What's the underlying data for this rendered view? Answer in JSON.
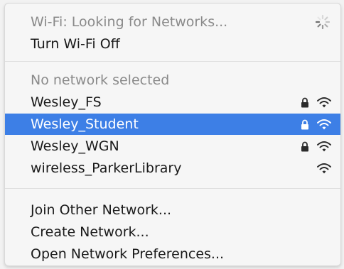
{
  "menu": {
    "status_item": "Wi-Fi: Looking for Networks...",
    "toggle_item": "Turn Wi-Fi Off",
    "section_header": "No network selected",
    "networks": [
      {
        "name": "Wesley_FS",
        "locked": true,
        "selected": false
      },
      {
        "name": "Wesley_Student",
        "locked": true,
        "selected": true
      },
      {
        "name": "Wesley_WGN",
        "locked": true,
        "selected": false
      },
      {
        "name": "wireless_ParkerLibrary",
        "locked": false,
        "selected": false
      }
    ],
    "actions": [
      "Join Other Network...",
      "Create Network...",
      "Open Network Preferences..."
    ]
  },
  "icons": {
    "spinner": "loading-spinner-icon",
    "lock": "lock-icon",
    "wifi": "wifi-signal-icon"
  },
  "colors": {
    "highlight": "#3d7fe6",
    "text": "#1a1a1a",
    "disabled_text": "#8a8a8a"
  }
}
